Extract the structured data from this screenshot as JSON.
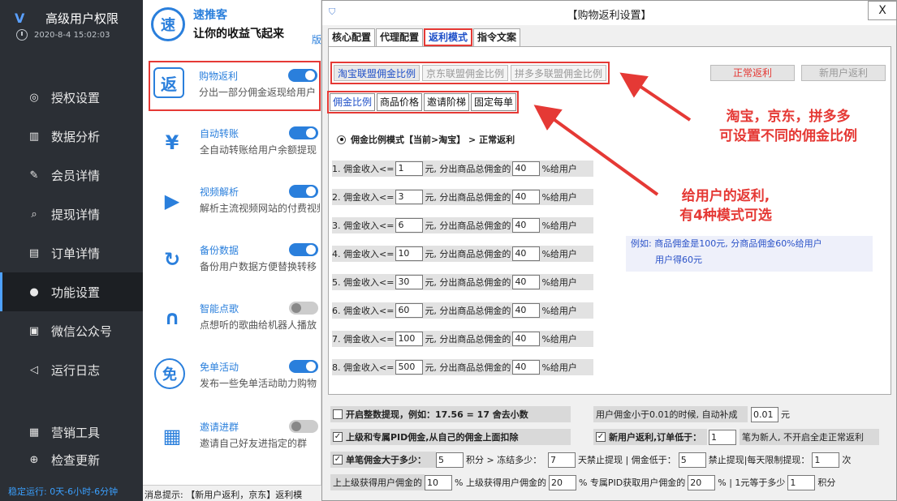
{
  "sidebar": {
    "app_title": "高级用户权限",
    "datetime": "2020-8-4 15:02:03",
    "items": [
      {
        "label": "授权设置",
        "icon": "key-icon"
      },
      {
        "label": "数据分析",
        "icon": "chart-icon"
      },
      {
        "label": "会员详情",
        "icon": "edit-icon"
      },
      {
        "label": "提现详情",
        "icon": "search-doc-icon"
      },
      {
        "label": "订单详情",
        "icon": "order-icon"
      },
      {
        "label": "功能设置",
        "icon": "wechat-icon",
        "active": true
      },
      {
        "label": "微信公众号",
        "icon": "official-account-icon"
      },
      {
        "label": "运行日志",
        "icon": "speaker-icon"
      }
    ],
    "bottom_items": [
      {
        "label": "营销工具",
        "icon": "tools-icon"
      },
      {
        "label": "检查更新",
        "icon": "update-icon"
      }
    ],
    "running": "稳定运行: 0天-6小时-6分钟"
  },
  "features": {
    "brand_logo": "速",
    "brand_name": "速推客",
    "brand_slogan": "让你的收益飞起来",
    "brand_more": "版",
    "items": [
      {
        "name": "购物返利",
        "desc": "分出一部分佣金返现给用户",
        "icon_glyph": "返",
        "on": true
      },
      {
        "name": "自动转账",
        "desc": "全自动转账给用户余额提现",
        "icon_glyph": "¥",
        "on": true
      },
      {
        "name": "视频解析",
        "desc": "解析主流视频网站的付费视频",
        "icon_glyph": "▶",
        "on": true
      },
      {
        "name": "备份数据",
        "desc": "备份用户数据方便替换转移",
        "icon_glyph": "↻",
        "on": true
      },
      {
        "name": "智能点歌",
        "desc": "点想听的歌曲给机器人播放",
        "icon_glyph": "∩",
        "on": false
      },
      {
        "name": "免单活动",
        "desc": "发布一些免单活动助力购物",
        "icon_glyph": "免",
        "on": true
      },
      {
        "name": "邀请进群",
        "desc": "邀请自己好友进指定的群",
        "icon_glyph": "▦",
        "on": false
      }
    ],
    "status_text": "消息提示: 【新用户返利，京东】返利模"
  },
  "dialog": {
    "title": "【购物返利设置】",
    "close": "X",
    "main_tabs": [
      "核心配置",
      "代理配置",
      "返利模式",
      "指令文案"
    ],
    "platform_tabs": [
      "淘宝联盟佣金比例",
      "京东联盟佣金比例",
      "拼多多联盟佣金比例"
    ],
    "right_buttons": [
      "正常返利",
      "新用户返利"
    ],
    "mode_tabs": [
      "佣金比例",
      "商品价格",
      "邀请阶梯",
      "固定每单"
    ],
    "radio_label": "佣金比例模式【当前>淘宝】 > 正常返利",
    "tiers": [
      {
        "prefix": "1. 佣金收入<=",
        "income": "1",
        "mid": "元, 分出商品总佣金的",
        "pct": "40",
        "suffix": "%给用户"
      },
      {
        "prefix": "2. 佣金收入<=",
        "income": "3",
        "mid": "元, 分出商品总佣金的",
        "pct": "40",
        "suffix": "%给用户"
      },
      {
        "prefix": "3. 佣金收入<=",
        "income": "6",
        "mid": "元, 分出商品总佣金的",
        "pct": "40",
        "suffix": "%给用户"
      },
      {
        "prefix": "4. 佣金收入<=",
        "income": "10",
        "mid": "元, 分出商品总佣金的",
        "pct": "40",
        "suffix": "%给用户"
      },
      {
        "prefix": "5. 佣金收入<=",
        "income": "30",
        "mid": "元, 分出商品总佣金的",
        "pct": "40",
        "suffix": "%给用户"
      },
      {
        "prefix": "6. 佣金收入<=",
        "income": "60",
        "mid": "元, 分出商品总佣金的",
        "pct": "40",
        "suffix": "%给用户"
      },
      {
        "prefix": "7. 佣金收入<=",
        "income": "100",
        "mid": "元, 分出商品总佣金的",
        "pct": "40",
        "suffix": "%给用户"
      },
      {
        "prefix": "8. 佣金收入<=",
        "income": "500",
        "mid": "元, 分出商品总佣金的",
        "pct": "40",
        "suffix": "%给用户"
      }
    ],
    "example_line1": "例如: 商品佣金是100元, 分商品佣金60%给用户",
    "example_line2": "用户得60元",
    "annotation1_line1": "淘宝，京东，拼多多",
    "annotation1_line2": "可设置不同的佣金比例",
    "annotation2_line1": "给用户的返利,",
    "annotation2_line2": "有4种模式可选",
    "bottom": {
      "r1_left": "开启整数提现，例如：17.56 = 17 舍去小数",
      "r1_right_label": "用户佣金小于0.01的时候, 自动补成",
      "r1_right_value": "0.01",
      "r1_right_unit": "元",
      "r2_left": "上级和专属PID佣金,从自己的佣金上面扣除",
      "r2_right_label": "新用户返利,订单低于：",
      "r2_right_value": "1",
      "r2_right_suffix": "笔为新人, 不开启全走正常返利",
      "r3_a": "单笔佣金大于多少：",
      "r3_a_val": "5",
      "r3_b": "积分 > 冻结多少：",
      "r3_b_val": "7",
      "r3_c": "天禁止提现 | 佣金低于：",
      "r3_c_val": "5",
      "r3_d": "禁止提现|每天限制提现：",
      "r3_d_val": "1",
      "r3_e": "次",
      "r4_a": "上上级获得用户佣金的",
      "r4_a_val": "10",
      "r4_b": "%  上级获得用户佣金的",
      "r4_b_val": "20",
      "r4_c": "% 专属PID获取用户佣金的",
      "r4_c_val": "20",
      "r4_d": "%  |  1元等于多少",
      "r4_d_val": "1",
      "r4_e": "积分"
    }
  },
  "colors": {
    "accent": "#2a7fdc",
    "annotation": "#e53935",
    "sidebar_bg": "#2b2f35"
  }
}
